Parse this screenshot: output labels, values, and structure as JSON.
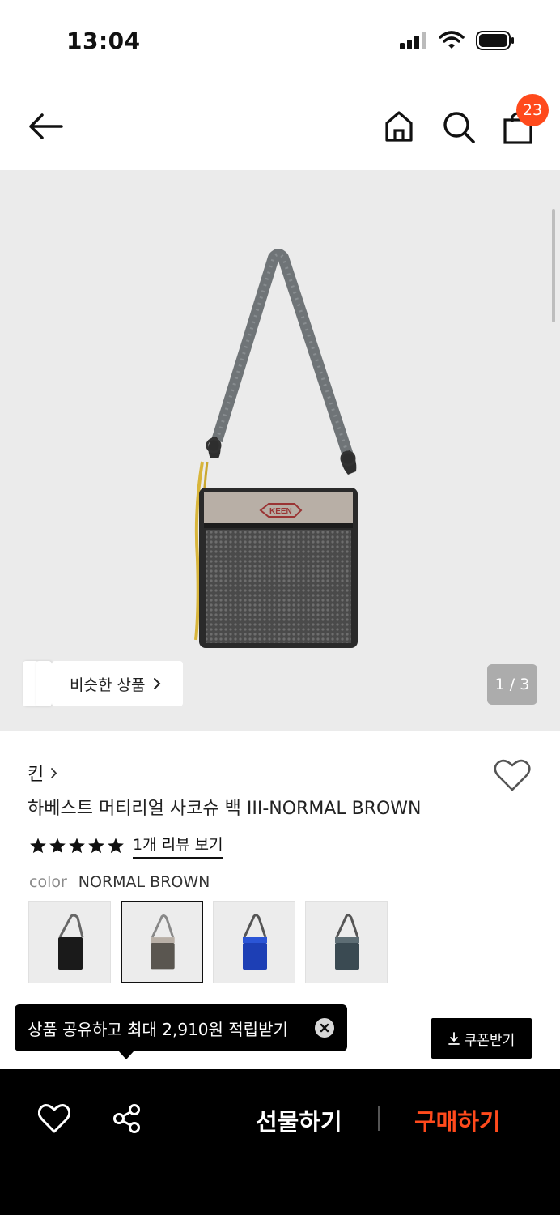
{
  "status_bar": {
    "time": "13:04"
  },
  "cart": {
    "count": "23"
  },
  "gallery": {
    "similar_label": "비슷한 상품",
    "pager": "1 / 3"
  },
  "product": {
    "brand": "킨",
    "title": "하베스트 머티리얼 사코슈 백 III-NORMAL BROWN",
    "rating": 5,
    "review_link": "1개 리뷰 보기",
    "color_label": "color",
    "color_value": "NORMAL BROWN",
    "swatches": [
      {
        "color": "#1a1a1a",
        "selected": false
      },
      {
        "color": "#7c7469",
        "selected": true
      },
      {
        "color": "#1d3fb5",
        "selected": false
      },
      {
        "color": "#3a4a52",
        "selected": false
      }
    ]
  },
  "promo": {
    "tooltip": "상품 공유하고 최대 2,910원 적립받기",
    "coupon": "쿠폰받기"
  },
  "bottom_bar": {
    "gift": "선물하기",
    "buy": "구매하기"
  },
  "colors": {
    "accent": "#ff4a1c",
    "hero_bg": "#ebebeb"
  }
}
